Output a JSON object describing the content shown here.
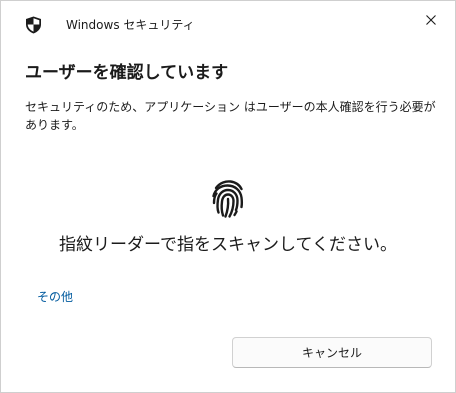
{
  "window": {
    "title": "Windows セキュリティ",
    "app_icon": "shield-icon",
    "close_icon": "close-icon"
  },
  "dialog": {
    "heading": "ユーザーを確認しています",
    "description": "セキュリティのため、アプリケーション はユーザーの本人確認を行う必要があります。",
    "fingerprint_icon": "fingerprint-icon",
    "instruction": "指紋リーダーで指をスキャンしてください。",
    "more_options_link": "その他",
    "cancel_label": "キャンセル"
  },
  "colors": {
    "link": "#005a9e",
    "background": "#ffffff",
    "button_background": "#fbfbfb",
    "button_border": "#d1d1d1"
  }
}
